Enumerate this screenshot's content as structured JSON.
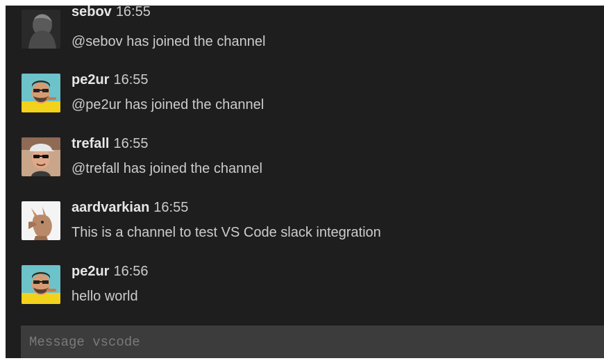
{
  "messages": [
    {
      "author": "sebov",
      "time": "16:55",
      "text": "@sebov has joined the channel",
      "avatar": "dark-silhouette-avatar"
    },
    {
      "author": "pe2ur",
      "time": "16:55",
      "text": "@pe2ur has joined the channel",
      "avatar": "bearded-man-avatar"
    },
    {
      "author": "trefall",
      "time": "16:55",
      "text": "@trefall has joined the channel",
      "avatar": "cap-sunglasses-man-avatar"
    },
    {
      "author": "aardvarkian",
      "time": "16:55",
      "text": "This is a channel to test VS Code slack integration",
      "avatar": "aardvark-avatar"
    },
    {
      "author": "pe2ur",
      "time": "16:56",
      "text": "hello world",
      "avatar": "bearded-man-avatar"
    }
  ],
  "composer": {
    "placeholder": "Message vscode",
    "value": ""
  },
  "colors": {
    "background": "#1e1e1e",
    "composer_background": "#3c3c3c",
    "text": "#cccccc",
    "author": "#e6e6e6"
  }
}
